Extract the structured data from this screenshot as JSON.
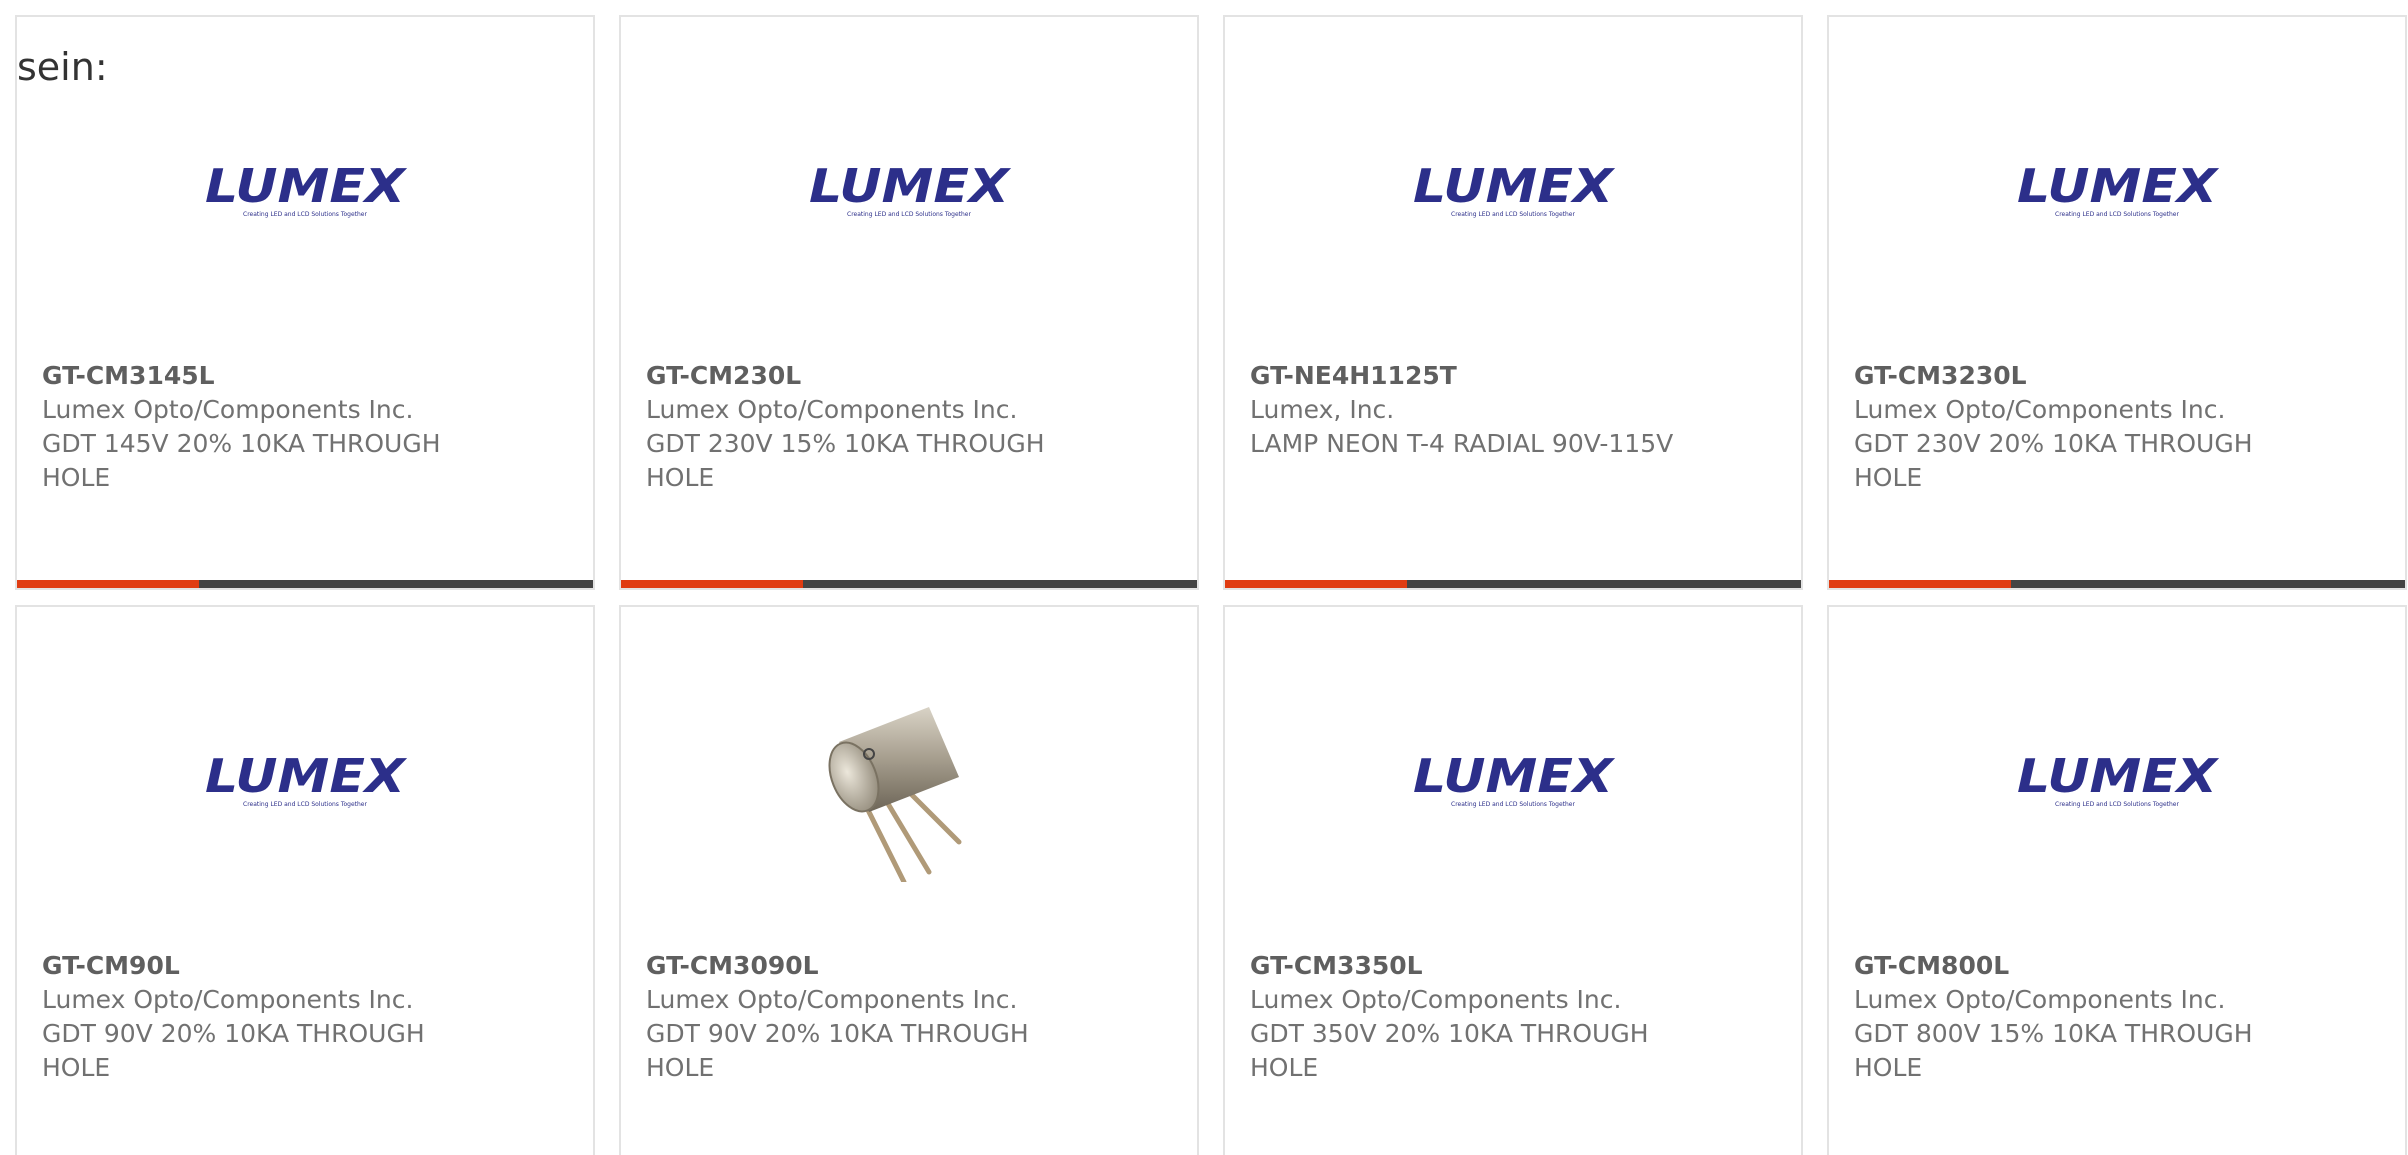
{
  "page_fragment": "sein:",
  "colors": {
    "accent_bar": "#e03c12",
    "dark_bar": "#444444",
    "logo_blue": "#2c2f8a"
  },
  "logo": {
    "wordmark": "LUMEX",
    "tagline": "Creating LED and LCD Solutions Together"
  },
  "products": [
    {
      "part_number": "GT-CM3145L",
      "manufacturer": "Lumex Opto/Components Inc.",
      "description": "GDT 145V 20% 10KA THROUGH HOLE",
      "image": "lumex-logo"
    },
    {
      "part_number": "GT-CM230L",
      "manufacturer": "Lumex Opto/Components Inc.",
      "description": "GDT 230V 15% 10KA THROUGH HOLE",
      "image": "lumex-logo"
    },
    {
      "part_number": "GT-NE4H1125T",
      "manufacturer": "Lumex, Inc.",
      "description": "LAMP NEON T-4 RADIAL 90V-115V",
      "image": "lumex-logo"
    },
    {
      "part_number": "GT-CM3230L",
      "manufacturer": "Lumex Opto/Components Inc.",
      "description": "GDT 230V 20% 10KA THROUGH HOLE",
      "image": "lumex-logo"
    },
    {
      "part_number": "GT-CM90L",
      "manufacturer": "Lumex Opto/Components Inc.",
      "description": "GDT 90V 20% 10KA THROUGH HOLE",
      "image": "lumex-logo"
    },
    {
      "part_number": "GT-CM3090L",
      "manufacturer": "Lumex Opto/Components Inc.",
      "description": "GDT 90V 20% 10KA THROUGH HOLE",
      "image": "gas-discharge-tube-photo"
    },
    {
      "part_number": "GT-CM3350L",
      "manufacturer": "Lumex Opto/Components Inc.",
      "description": "GDT 350V 20% 10KA THROUGH HOLE",
      "image": "lumex-logo"
    },
    {
      "part_number": "GT-CM800L",
      "manufacturer": "Lumex Opto/Components Inc.",
      "description": "GDT 800V 15% 10KA THROUGH HOLE",
      "image": "lumex-logo"
    }
  ]
}
